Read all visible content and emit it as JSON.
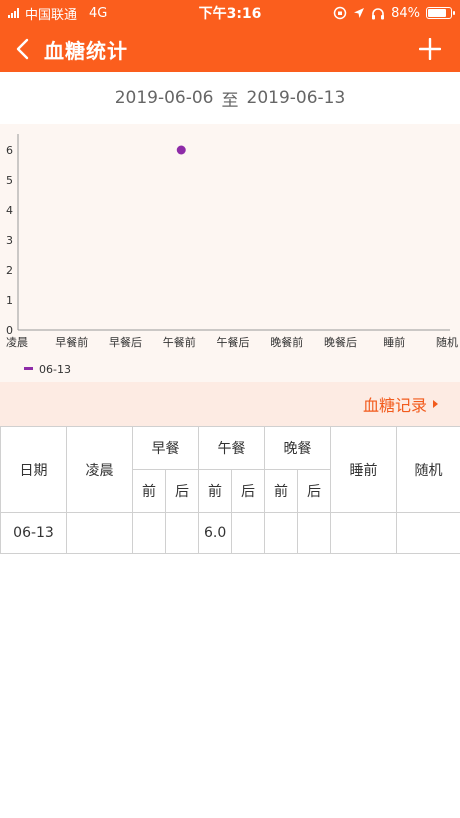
{
  "status_bar": {
    "carrier": "中国联通",
    "network": "4G",
    "time": "下午3:16",
    "battery": "84%",
    "battery_level": 0.84
  },
  "nav": {
    "title": "血糖统计",
    "back_icon": "chevron-left-icon",
    "add_icon": "plus-icon"
  },
  "date_range": {
    "start": "2019-06-06",
    "separator": "至",
    "end": "2019-06-13"
  },
  "chart_data": {
    "type": "scatter",
    "categories": [
      "凌晨",
      "早餐前",
      "早餐后",
      "午餐前",
      "午餐后",
      "晚餐前",
      "晚餐后",
      "睡前",
      "随机"
    ],
    "yticks": [
      0,
      1,
      2,
      3,
      4,
      5,
      6
    ],
    "ylim": [
      0,
      6
    ],
    "series": [
      {
        "name": "06-13",
        "color": "#8e2ba8",
        "points": [
          {
            "category": "午餐前",
            "y": 6.0
          }
        ]
      }
    ],
    "legend_position": "bottom-left",
    "grid": false
  },
  "records": {
    "label": "血糖记录"
  },
  "table": {
    "headers": {
      "date": "日期",
      "early": "凌晨",
      "breakfast": "早餐",
      "lunch": "午餐",
      "dinner": "晚餐",
      "bedtime": "睡前",
      "random": "随机",
      "before": "前",
      "after": "后"
    },
    "rows": [
      {
        "date": "06-13",
        "early": "",
        "breakfast_before": "",
        "breakfast_after": "",
        "lunch_before": "6.0",
        "lunch_after": "",
        "dinner_before": "",
        "dinner_after": "",
        "bedtime": "",
        "random": ""
      }
    ]
  },
  "colors": {
    "brand": "#fb5e1d",
    "series": "#8e2ba8",
    "link": "#f25b1d"
  }
}
